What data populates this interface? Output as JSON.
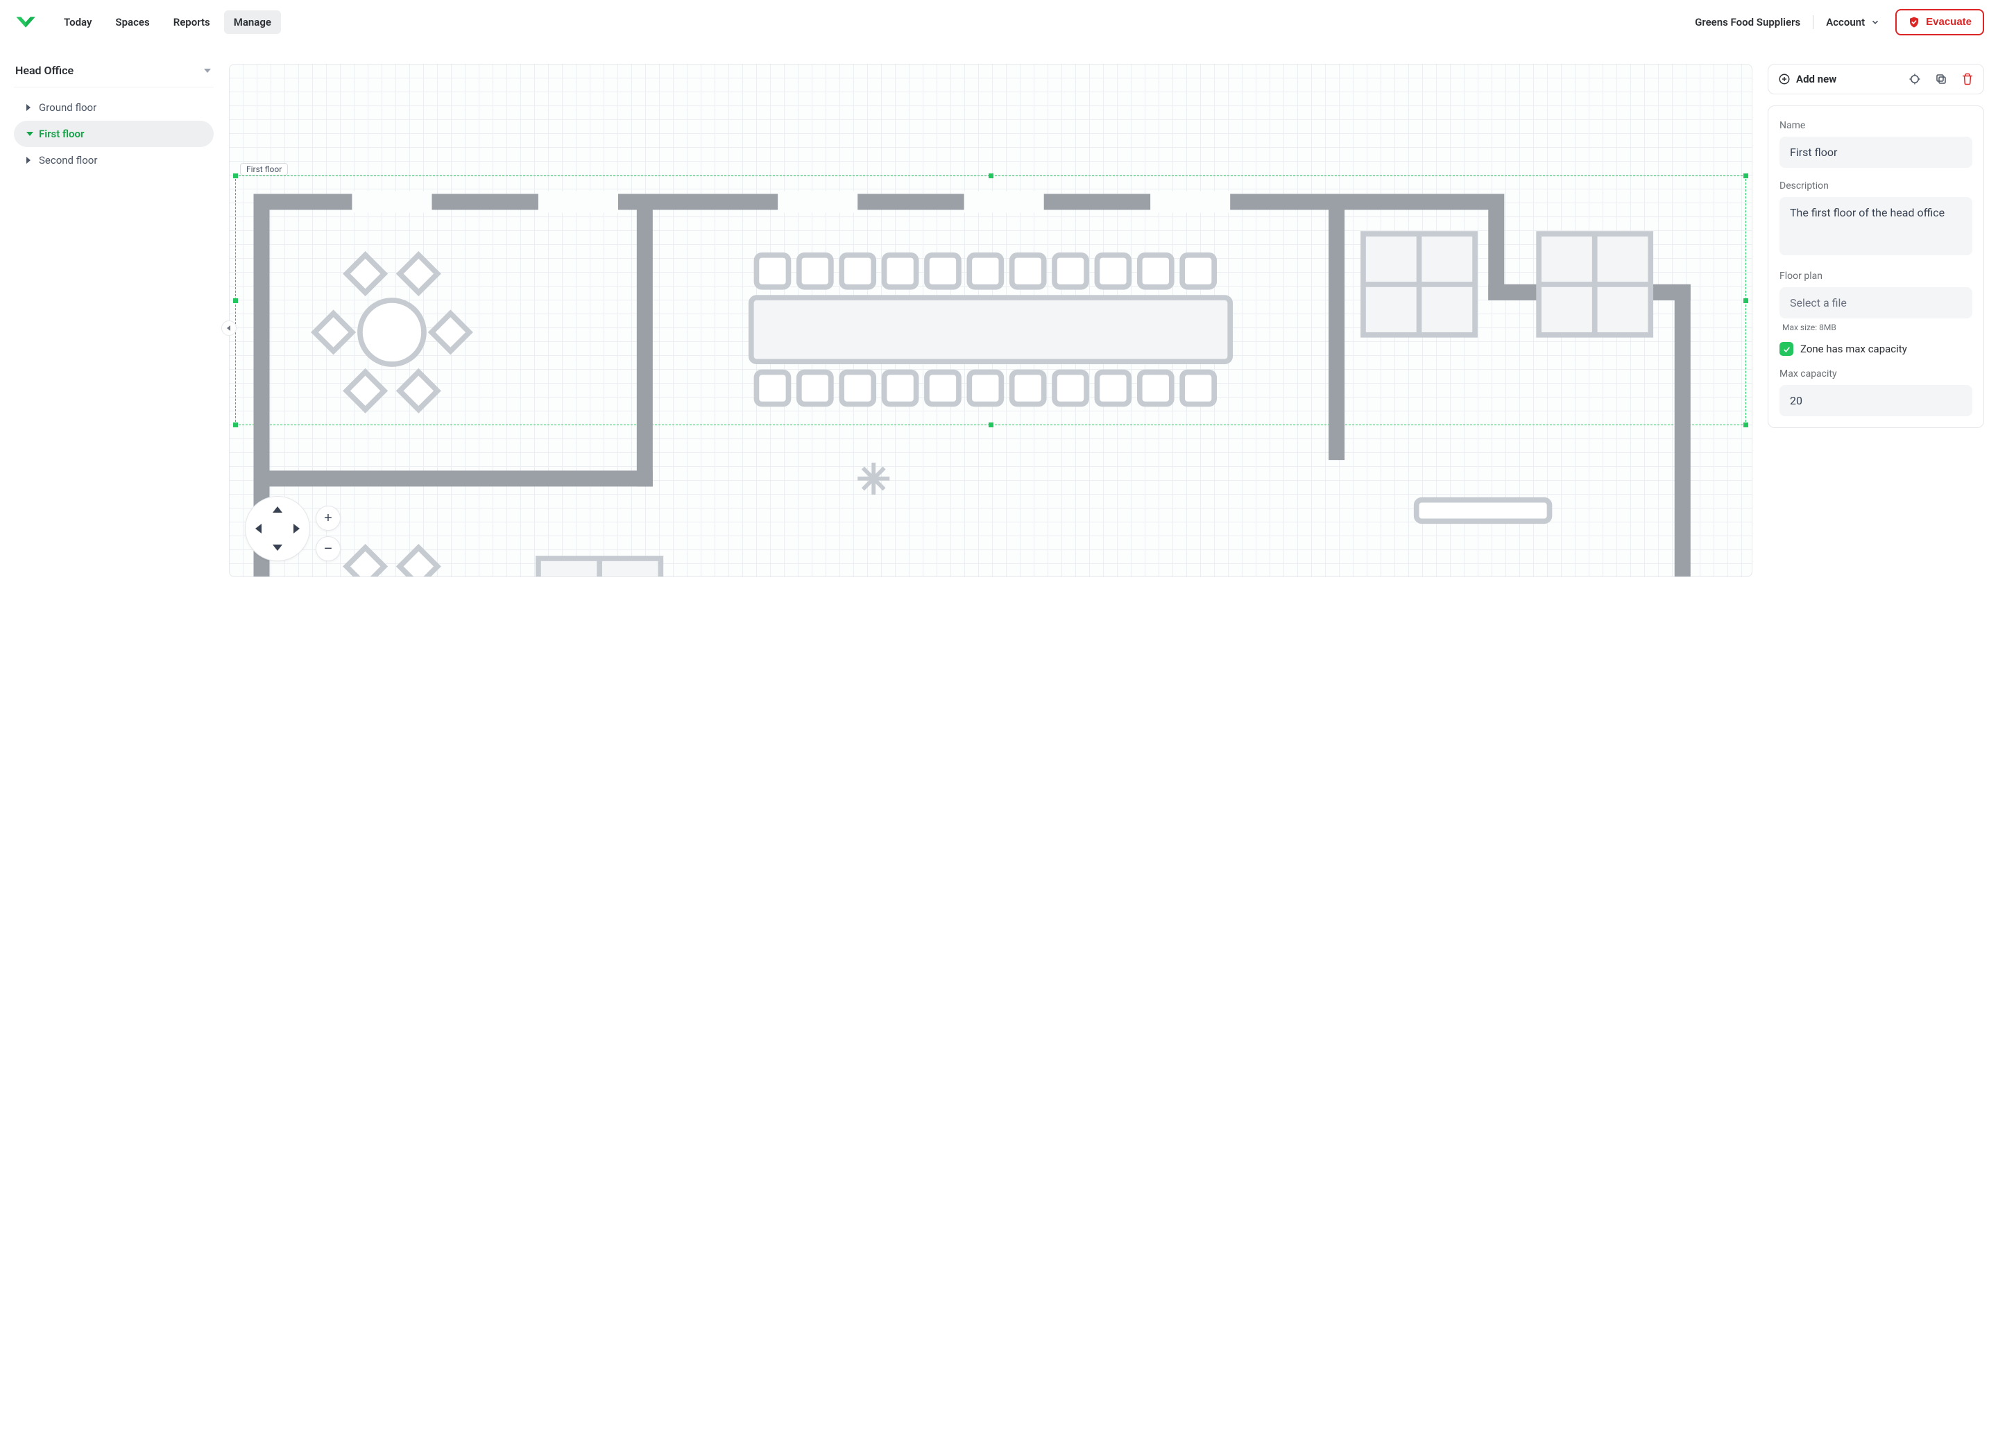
{
  "nav": {
    "links": [
      "Today",
      "Spaces",
      "Reports",
      "Manage"
    ],
    "active_index": 3,
    "org": "Greens Food Suppliers",
    "account_label": "Account",
    "evacuate_label": "Evacuate"
  },
  "sidebar": {
    "location": "Head Office",
    "tree": [
      {
        "label": "Ground floor",
        "expanded": false,
        "selected": false
      },
      {
        "label": "First floor",
        "expanded": true,
        "selected": true
      },
      {
        "label": "Second floor",
        "expanded": false,
        "selected": false
      }
    ]
  },
  "canvas": {
    "zone_label": "First floor"
  },
  "panel": {
    "add_new_label": "Add new",
    "name_label": "Name",
    "name_value": "First floor",
    "description_label": "Description",
    "description_value": "The first floor of the head office",
    "floorplan_label": "Floor plan",
    "floorplan_placeholder": "Select a file",
    "floorplan_hint": "Max size: 8MB",
    "has_max_cap_label": "Zone has max capacity",
    "has_max_cap": true,
    "max_cap_label": "Max capacity",
    "max_cap_value": "20"
  },
  "icons": {
    "target": "target-icon",
    "copy": "copy-icon",
    "trash": "trash-icon",
    "plus": "plus-circle-icon",
    "chevron_down": "chevron-down-icon",
    "shield": "shield-check-icon"
  },
  "colors": {
    "accent": "#22c55e",
    "danger": "#dc2626"
  }
}
